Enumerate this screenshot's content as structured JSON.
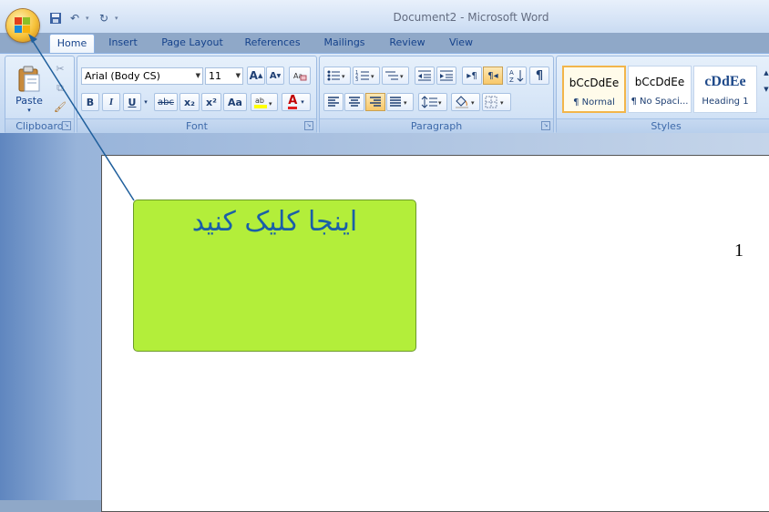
{
  "window": {
    "title": "Document2 - Microsoft Word"
  },
  "tabs": [
    "Home",
    "Insert",
    "Page Layout",
    "References",
    "Mailings",
    "Review",
    "View"
  ],
  "clipboard": {
    "paste_label": "Paste",
    "group_label": "Clipboard"
  },
  "font": {
    "name_value": "Arial (Body CS)",
    "size_value": "11",
    "group_label": "Font",
    "bold": "B",
    "italic": "I",
    "underline": "U",
    "strike": "abc",
    "subscript": "x₂",
    "superscript": "x²",
    "change_case": "Aa",
    "font_color": "A"
  },
  "paragraph": {
    "group_label": "Paragraph"
  },
  "styles": {
    "group_label": "Styles",
    "items": [
      {
        "preview": "bCcDdEe",
        "name": "¶ Normal"
      },
      {
        "preview": "bCcDdEe",
        "name": "¶ No Spaci..."
      },
      {
        "preview": "cDdEe",
        "name": "Heading 1"
      }
    ]
  },
  "callout": {
    "text": "اینجا کلیک کنید"
  },
  "document": {
    "text": "1"
  },
  "colors": {
    "callout_fill": "#b3ee3a",
    "callout_text": "#1a5fa8",
    "arrow": "#1f5f9c"
  }
}
